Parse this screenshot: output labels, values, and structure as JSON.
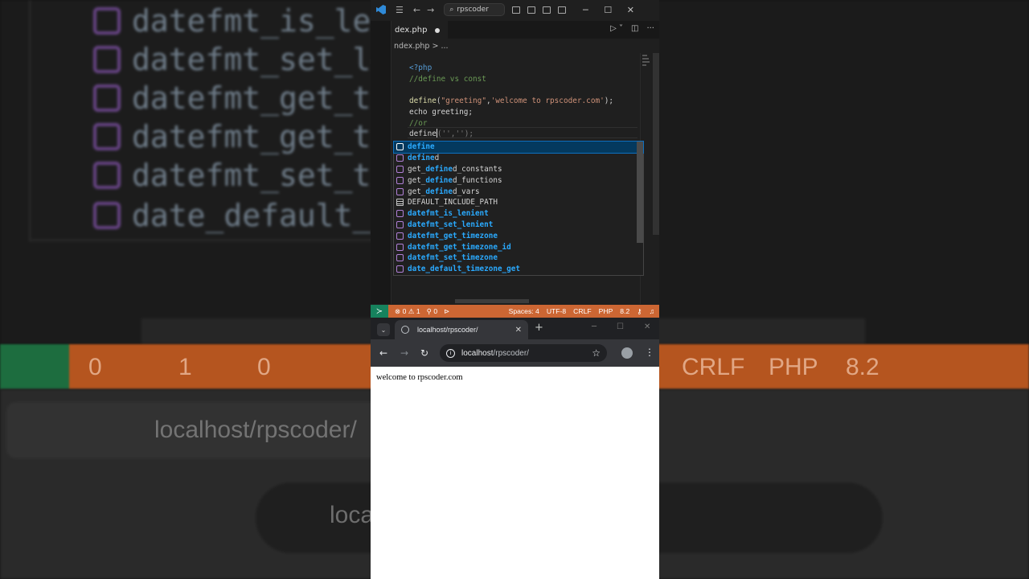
{
  "vscode": {
    "search_label": "rpscoder",
    "tab_label": "dex.php",
    "breadcrumb": "ndex.php > ...",
    "code_lines": {
      "l1": "<?php",
      "l2": "//define vs const",
      "l4_fn": "define",
      "l4_args_open": "(",
      "l4_str1": "\"greeting\"",
      "l4_comma": ",",
      "l4_str2": "'welcome to rpscoder.com'",
      "l4_close": ");",
      "l5": "echo greeting;",
      "l6": "//or",
      "l7_fn": "define",
      "l7_ghost": "('','');"
    },
    "suggestions": [
      {
        "pre": "",
        "match": "define",
        "post": "",
        "kind": "method",
        "selected": true
      },
      {
        "pre": "",
        "match": "define",
        "post": "d",
        "kind": "method",
        "selected": false
      },
      {
        "pre": "get_",
        "match": "define",
        "post": "d_constants",
        "kind": "method",
        "selected": false
      },
      {
        "pre": "get_",
        "match": "define",
        "post": "d_functions",
        "kind": "method",
        "selected": false
      },
      {
        "pre": "get_",
        "match": "define",
        "post": "d_vars",
        "kind": "method",
        "selected": false
      },
      {
        "pre": "",
        "match": "DEFAULT_INCLUDE_PATH",
        "post": "",
        "kind": "constant",
        "selected": false
      },
      {
        "pre": "",
        "match": "datefmt_is_lenient",
        "post": "",
        "kind": "method",
        "selected": false
      },
      {
        "pre": "",
        "match": "datefmt_set_lenient",
        "post": "",
        "kind": "method",
        "selected": false
      },
      {
        "pre": "",
        "match": "datefmt_get_timezone",
        "post": "",
        "kind": "method",
        "selected": false
      },
      {
        "pre": "",
        "match": "datefmt_get_timezone_id",
        "post": "",
        "kind": "method",
        "selected": false
      },
      {
        "pre": "",
        "match": "datefmt_set_timezone",
        "post": "",
        "kind": "method",
        "selected": false
      },
      {
        "pre": "",
        "match": "date_default_timezone_get",
        "post": "",
        "kind": "method",
        "selected": false
      }
    ],
    "status": {
      "errors": "0",
      "warnings": "1",
      "ports": "0",
      "spaces": "Spaces: 4",
      "encoding": "UTF-8",
      "eol": "CRLF",
      "language": "PHP",
      "version": "8.2"
    }
  },
  "chrome": {
    "tab_title": "localhost/rpscoder/",
    "url_host": "localhost",
    "url_path": "/rpscoder/",
    "page_text": "welcome to rpscoder.com"
  },
  "background": {
    "rows": [
      "datefmt_is_leni",
      "datefmt_set_len",
      "datefmt_get_tim",
      "datefmt_get_tim",
      "datefmt_set_tim",
      "date_default_ti"
    ],
    "status_items": [
      "0",
      "1",
      "0",
      "CRLF",
      "PHP",
      "8.2"
    ],
    "url": "localhost/rpscoder/",
    "url_short": "loca"
  },
  "colors": {
    "status_bar": "#cc6633",
    "remote": "#16825d",
    "suggest_selected": "#04395e",
    "match_highlight": "#2aaaff"
  }
}
